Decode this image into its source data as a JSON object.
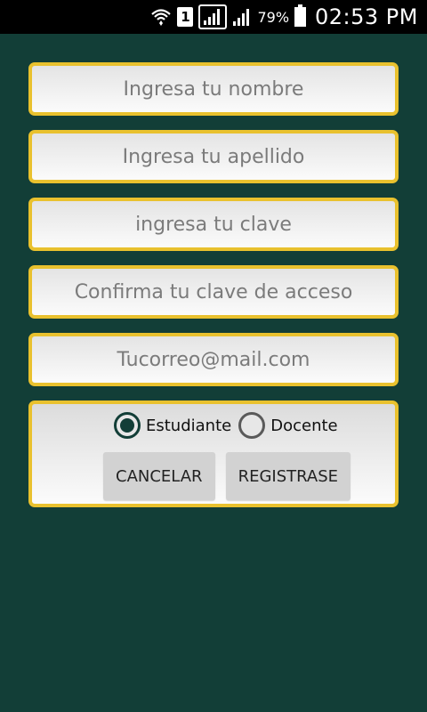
{
  "status_bar": {
    "sim": "1",
    "battery_pct": "79%",
    "time": "02:53 PM"
  },
  "form": {
    "nombre_placeholder": "Ingresa tu nombre",
    "apellido_placeholder": "Ingresa tu apellido",
    "clave_placeholder": "ingresa tu clave",
    "confirmar_placeholder": "Confirma tu clave de acceso",
    "correo_placeholder": "Tucorreo@mail.com",
    "role": {
      "estudiante_label": "Estudiante",
      "docente_label": "Docente",
      "selected": "Estudiante"
    },
    "cancel_label": "CANCELAR",
    "register_label": "REGISTRASE"
  },
  "colors": {
    "background": "#123e37",
    "field_border": "#e9c12e"
  }
}
